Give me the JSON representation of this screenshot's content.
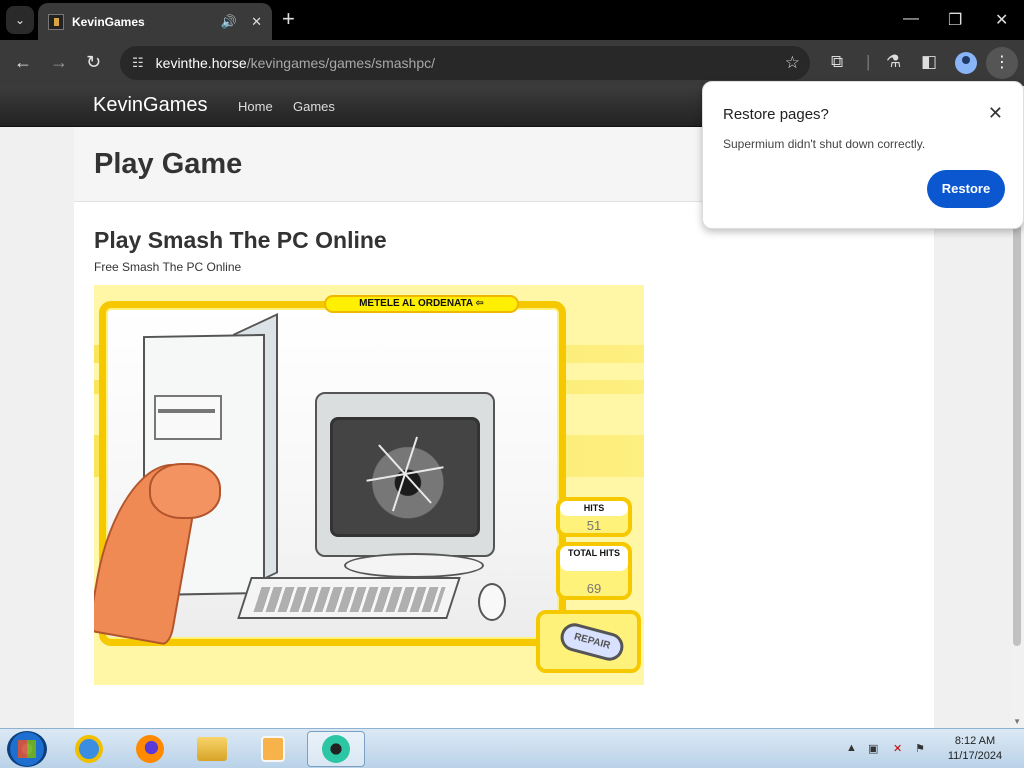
{
  "browser": {
    "tab": {
      "title": "KevinGames"
    },
    "url": {
      "host": "kevinthe.horse",
      "path": "/kevingames/games/smashpc/"
    }
  },
  "site": {
    "brand": "KevinGames",
    "nav": [
      "Home",
      "Games"
    ],
    "jumbotron_title": "Play Game",
    "game_title": "Play Smash The PC Online",
    "game_subtitle": "Free Smash The PC Online"
  },
  "game": {
    "label": "METELE AL ORDENATA",
    "hits_label": "HITS",
    "hits": "51",
    "total_hits_label": "TOTAL HITS",
    "total_hits": "69",
    "repair": "REPAIR"
  },
  "popup": {
    "title": "Restore pages?",
    "message": "Supermium didn't shut down correctly.",
    "button": "Restore"
  },
  "taskbar": {
    "time": "8:12 AM",
    "date": "11/17/2024"
  },
  "colors": {
    "accent_blue": "#0b57d0",
    "game_yellow": "#f5c800"
  }
}
